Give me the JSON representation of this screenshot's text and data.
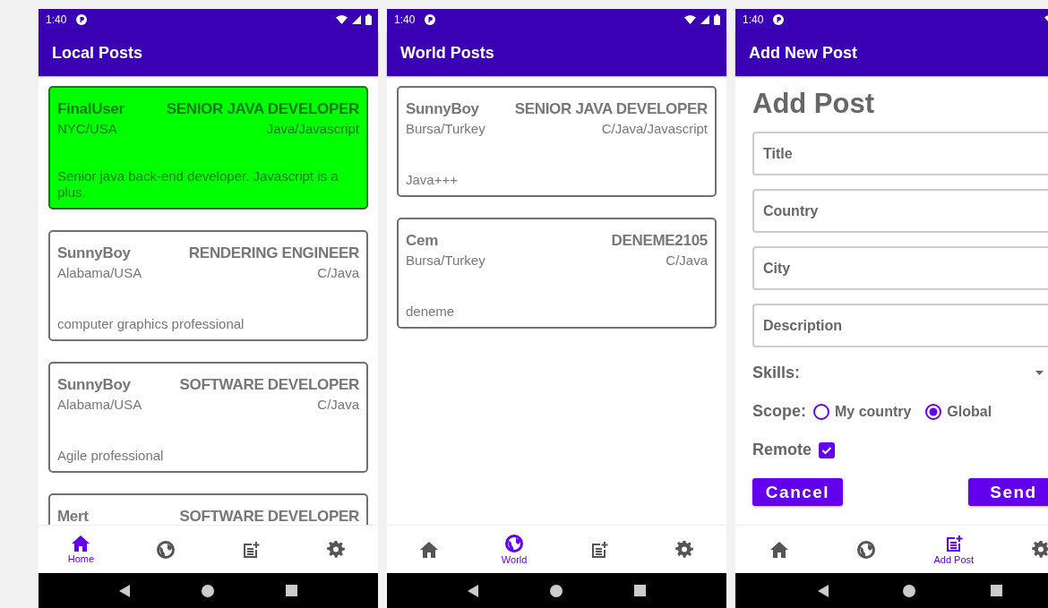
{
  "screens": [
    {
      "status_time": "1:40",
      "title": "Local Posts",
      "posts": [
        {
          "user": "FinalUser",
          "job": "SENIOR JAVA DEVELOPER",
          "location": "NYC/USA",
          "skills": "Java/Javascript",
          "description": "Senior java back-end developer. Javascript is a plus.",
          "selected": true
        },
        {
          "user": "SunnyBoy",
          "job": "RENDERING ENGINEER",
          "location": "Alabama/USA",
          "skills": "C/Java",
          "description": "computer graphics professional",
          "selected": false
        },
        {
          "user": "SunnyBoy",
          "job": "SOFTWARE DEVELOPER",
          "location": "Alabama/USA",
          "skills": "C/Java",
          "description": "Agile professional",
          "selected": false
        },
        {
          "user": "Mert",
          "job": "SOFTWARE DEVELOPER",
          "selected": false
        }
      ],
      "nav": [
        {
          "kind": "home",
          "selected": true,
          "label": "Home"
        },
        {
          "kind": "world",
          "selected": false
        },
        {
          "kind": "add_post",
          "selected": false
        },
        {
          "kind": "settings",
          "selected": false
        }
      ]
    },
    {
      "status_time": "1:40",
      "title": "World Posts",
      "posts": [
        {
          "user": "SunnyBoy",
          "job": "SENIOR JAVA DEVELOPER",
          "location": "Bursa/Turkey",
          "skills": "C/Java/Javascript",
          "description": "Java+++",
          "selected": false
        },
        {
          "user": "Cem",
          "job": "DENEME2105",
          "location": "Bursa/Turkey",
          "skills": "C/Java",
          "description": "deneme",
          "selected": false
        }
      ],
      "nav": [
        {
          "kind": "home",
          "selected": false
        },
        {
          "kind": "world",
          "selected": true,
          "label": "World"
        },
        {
          "kind": "add_post",
          "selected": false
        },
        {
          "kind": "settings",
          "selected": false
        }
      ]
    },
    {
      "status_time": "1:40",
      "title": "Add New Post",
      "form": {
        "heading": "Add Post",
        "fields": [
          {
            "placeholder": "Title"
          },
          {
            "placeholder": "Country"
          },
          {
            "placeholder": "City"
          },
          {
            "placeholder": "Description"
          }
        ],
        "skills": {
          "label": "Skills:"
        },
        "scope": {
          "label": "Scope:",
          "options": [
            {
              "label": "My country",
              "selected": false
            },
            {
              "label": "Global",
              "selected": true
            }
          ]
        },
        "remote": {
          "label": "Remote",
          "checked": true
        },
        "buttons": [
          {
            "label": "Cancel"
          },
          {
            "label": "Send"
          }
        ]
      },
      "nav": [
        {
          "kind": "home",
          "selected": false
        },
        {
          "kind": "world",
          "selected": false
        },
        {
          "kind": "add_post",
          "selected": true,
          "label": "Add Post"
        },
        {
          "kind": "settings",
          "selected": false
        }
      ]
    }
  ]
}
